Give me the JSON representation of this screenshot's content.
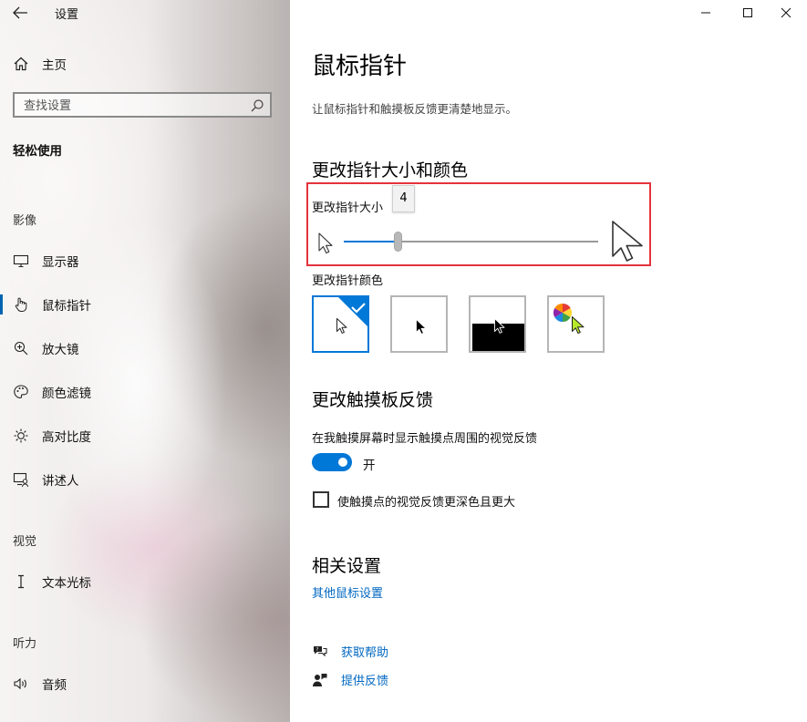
{
  "app": {
    "title": "设置"
  },
  "window_controls": [
    "minimize-icon",
    "maximize-icon",
    "close-icon"
  ],
  "sidebar": {
    "home_label": "主页",
    "search_placeholder": "查找设置",
    "section_title": "轻松使用",
    "groups": {
      "vision": "影像",
      "interaction": "视觉",
      "hearing": "听力"
    },
    "items": {
      "display": {
        "label": "显示器",
        "icon": "monitor-icon"
      },
      "mouse_pointer": {
        "label": "鼠标指针",
        "icon": "pointer-hand-icon",
        "selected": true
      },
      "magnifier": {
        "label": "放大镜",
        "icon": "magnifier-icon"
      },
      "color_filter": {
        "label": "颜色滤镜",
        "icon": "palette-icon"
      },
      "high_contrast": {
        "label": "高对比度",
        "icon": "sun-icon"
      },
      "narrator": {
        "label": "讲述人",
        "icon": "narrator-icon"
      },
      "text_cursor": {
        "label": "文本光标",
        "icon": "text-cursor-icon"
      },
      "audio": {
        "label": "音频",
        "icon": "speaker-icon"
      }
    }
  },
  "main": {
    "title": "鼠标指针",
    "description": "让鼠标指针和触摸板反馈更清楚地显示。",
    "size_color_heading": "更改指针大小和颜色",
    "size_label": "更改指针大小",
    "size_slider": {
      "value": "4",
      "min": 1,
      "max": 15
    },
    "color_label": "更改指针颜色",
    "color_options": [
      "white",
      "black",
      "inverted",
      "custom"
    ],
    "selected_color_option": "white",
    "accent_color": "#0078d7",
    "touch_heading": "更改触摸板反馈",
    "touch_feedback_label": "在我触摸屏幕时显示触摸点周围的视觉反馈",
    "touch_toggle": {
      "on": true,
      "state_label": "开"
    },
    "darker_feedback_label": "使触摸点的视觉反馈更深色且更大",
    "darker_feedback_checked": false,
    "related_heading": "相关设置",
    "other_mouse_settings_link": "其他鼠标设置",
    "help_link": "获取帮助",
    "feedback_link": "提供反馈"
  }
}
